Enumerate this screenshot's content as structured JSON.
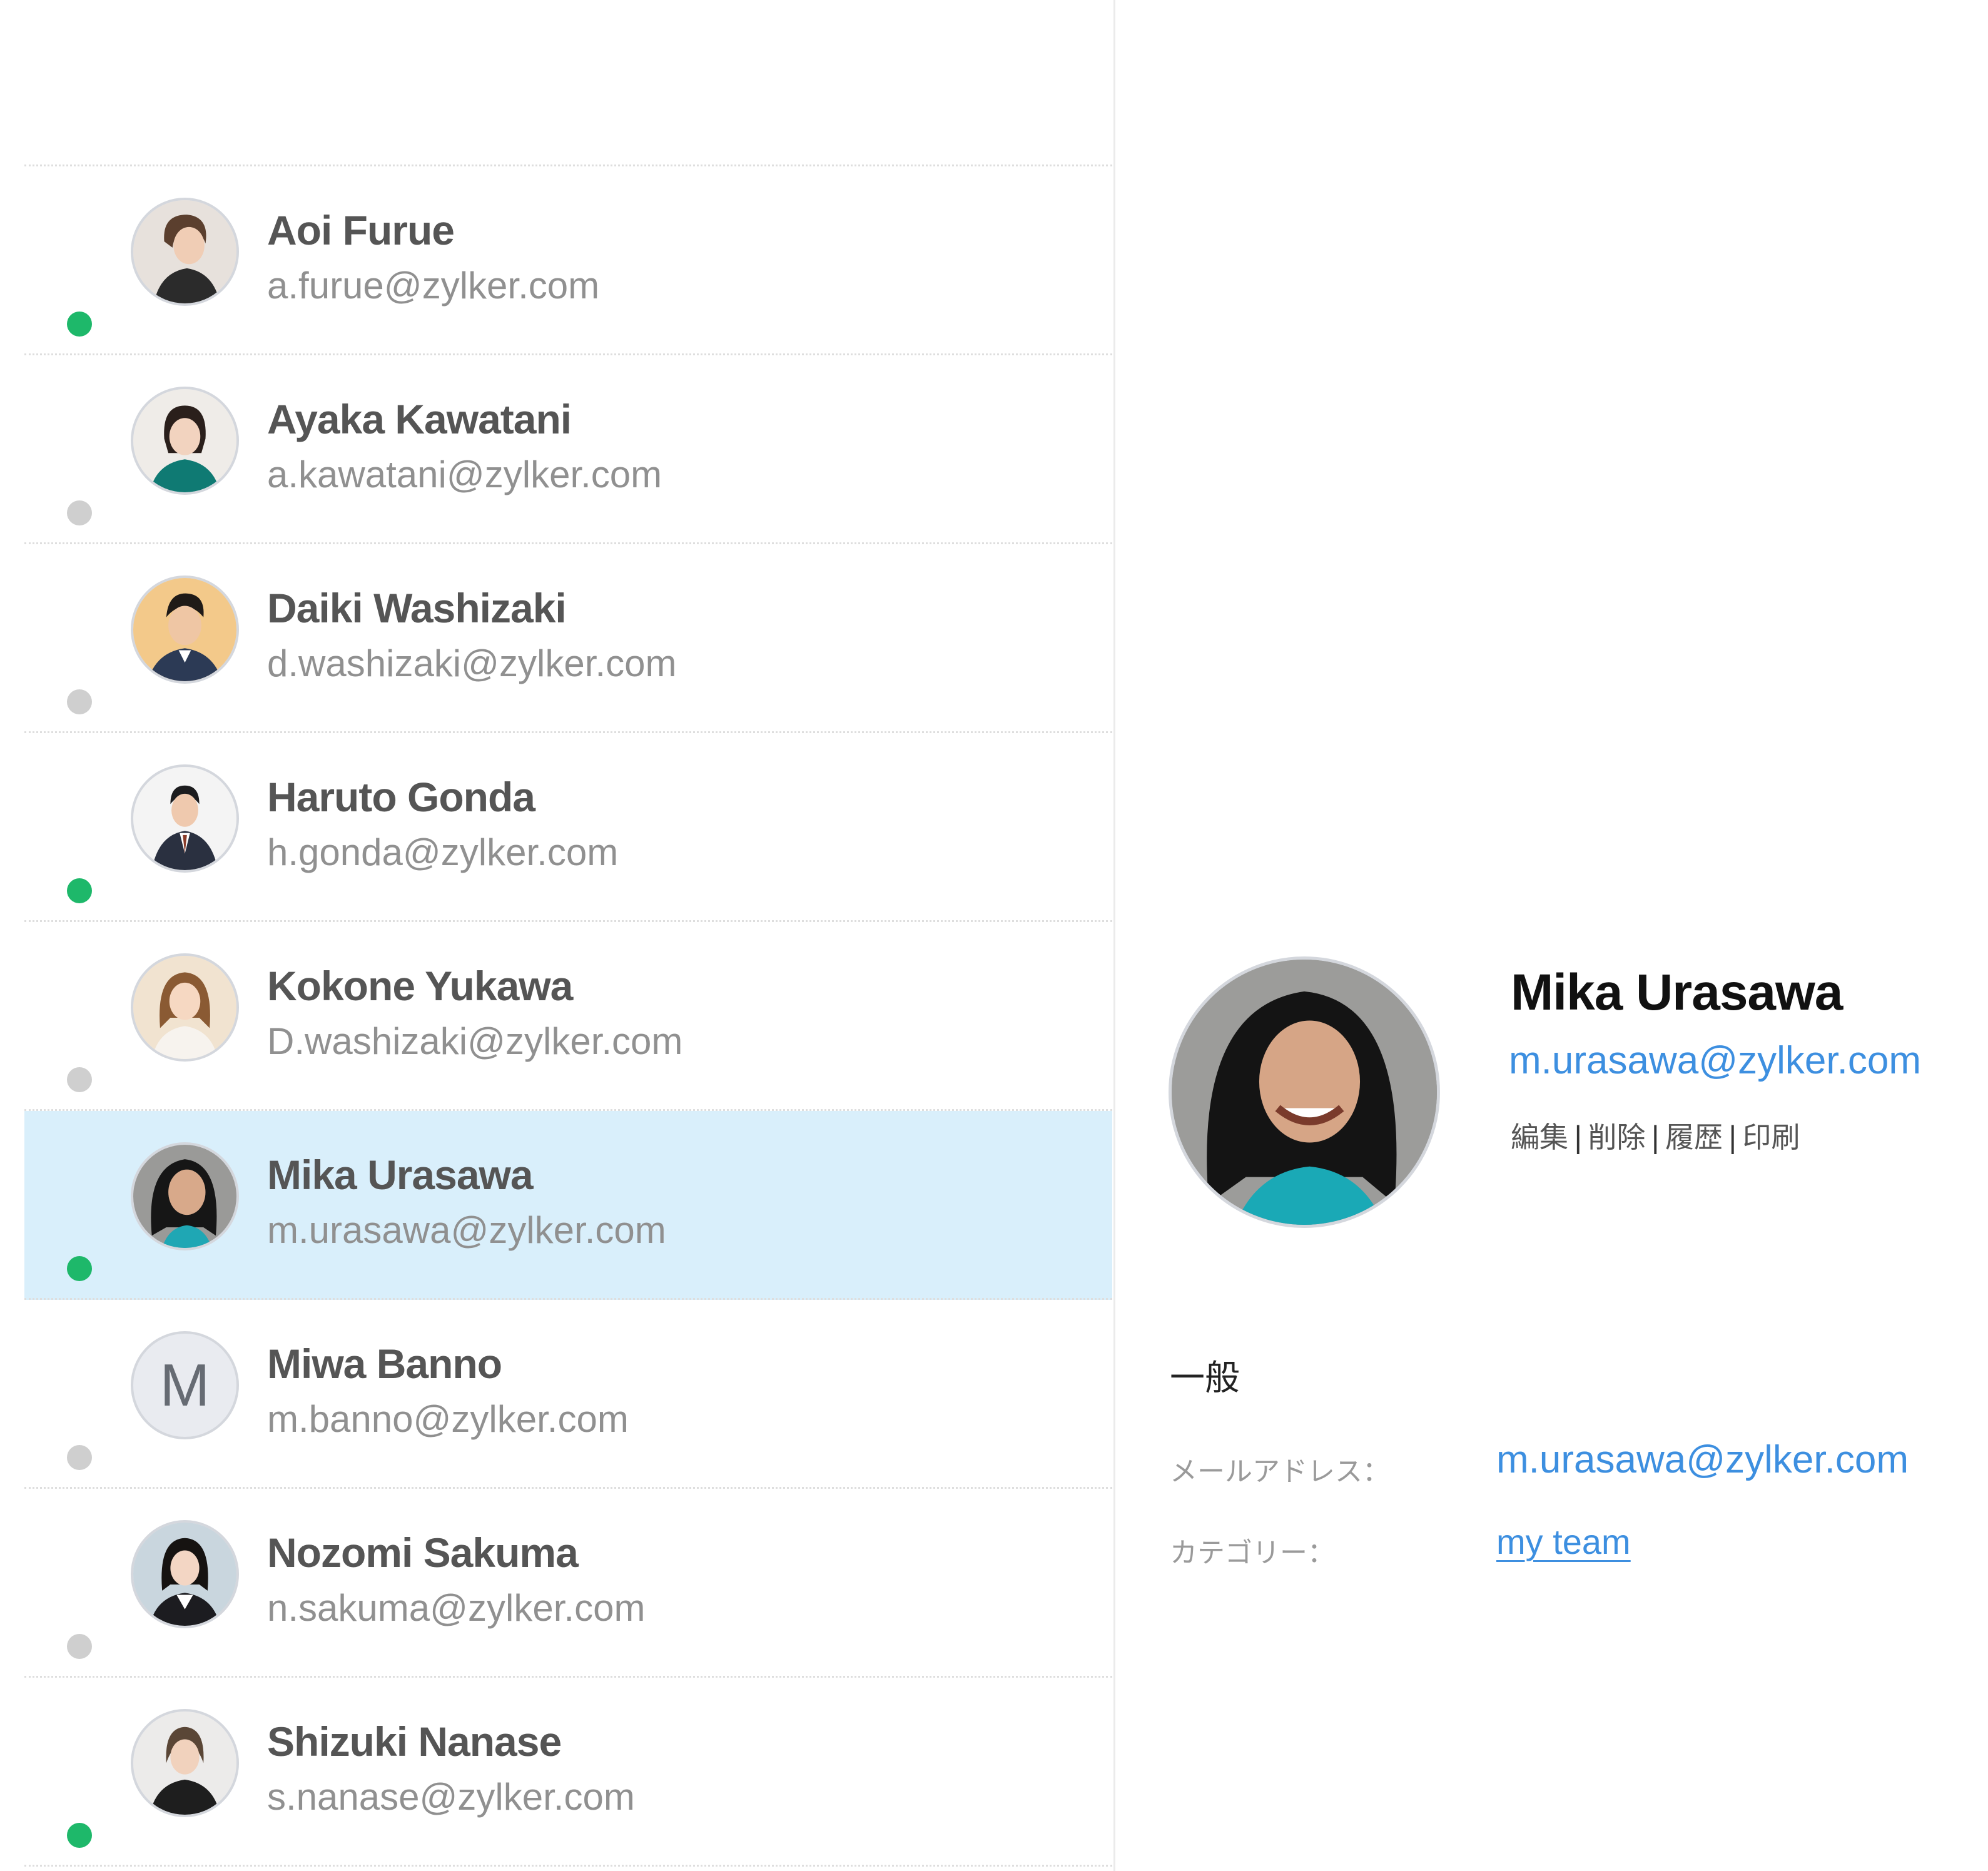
{
  "contacts": [
    {
      "name": "Aoi Furue",
      "email": "a.furue@zylker.com",
      "status": "online",
      "avatar": "photo"
    },
    {
      "name": "Ayaka Kawatani",
      "email": "a.kawatani@zylker.com",
      "status": "offline",
      "avatar": "photo"
    },
    {
      "name": "Daiki Washizaki",
      "email": "d.washizaki@zylker.com",
      "status": "offline",
      "avatar": "photo"
    },
    {
      "name": "Haruto Gonda",
      "email": "h.gonda@zylker.com",
      "status": "online",
      "avatar": "photo"
    },
    {
      "name": "Kokone Yukawa",
      "email": "D.washizaki@zylker.com",
      "status": "offline",
      "avatar": "photo"
    },
    {
      "name": "Mika Urasawa",
      "email": "m.urasawa@zylker.com",
      "status": "online",
      "avatar": "photo",
      "selected": true
    },
    {
      "name": "Miwa Banno",
      "email": "m.banno@zylker.com",
      "status": "offline",
      "avatar": "initial",
      "initial": "M"
    },
    {
      "name": "Nozomi Sakuma",
      "email": "n.sakuma@zylker.com",
      "status": "offline",
      "avatar": "photo"
    },
    {
      "name": "Shizuki Nanase",
      "email": "s.nanase@zylker.com",
      "status": "online",
      "avatar": "photo"
    }
  ],
  "detail": {
    "name": "Mika Urasawa",
    "email": "m.urasawa@zylker.com",
    "actions": {
      "edit": "編集",
      "delete": "削除",
      "history": "履歴",
      "print": "印刷",
      "separator": "|"
    },
    "section_title": "一般",
    "fields": {
      "email_label": "メールアドレス：",
      "email_value": "m.urasawa@zylker.com",
      "category_label": "カテゴリー：",
      "category_value": "my team"
    }
  },
  "colors": {
    "online": "#1eb86a",
    "offline": "#cfcfcf",
    "selected_row": "#d9effb",
    "link": "#3d8fe0"
  }
}
